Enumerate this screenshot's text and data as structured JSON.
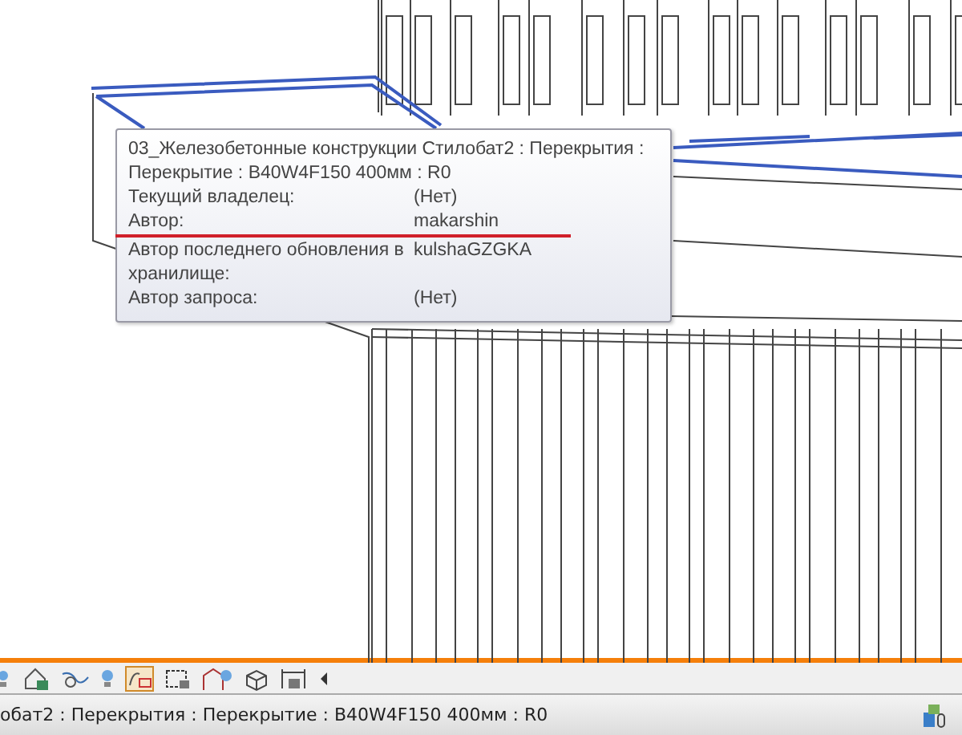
{
  "tooltip": {
    "title": "03_Железобетонные конструкции Стилобат2 : Перекрытия : Перекрытие : B40W4F150 400мм : R0",
    "rows": [
      {
        "label": "Текущий владелец:",
        "value": "(Нет)"
      },
      {
        "label": "Автор:",
        "value": "makarshin"
      },
      {
        "label": "Автор последнего обновления в хранилище:",
        "value": "kulshaGZGKA"
      },
      {
        "label": "Автор запроса:",
        "value": "(Нет)"
      }
    ]
  },
  "status_bar": {
    "text": "обат2 : Перекрытия : Перекрытие : B40W4F150 400мм : R0"
  }
}
